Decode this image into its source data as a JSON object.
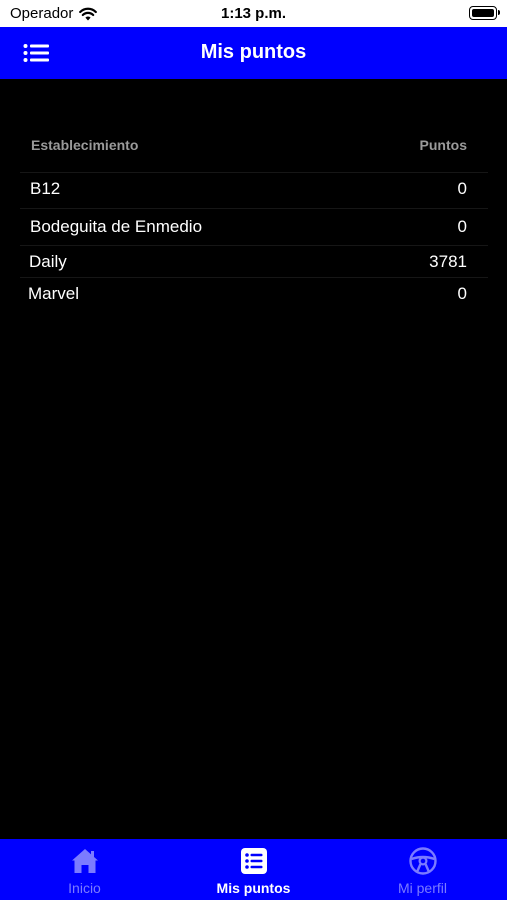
{
  "status_bar": {
    "carrier": "Operador",
    "time": "1:13 p.m."
  },
  "nav": {
    "title": "Mis puntos",
    "menu_icon": "list-icon"
  },
  "table": {
    "header_establishment": "Establecimiento",
    "header_points": "Puntos",
    "rows": [
      {
        "name": "B12",
        "points": "0"
      },
      {
        "name": "Bodeguita de Enmedio",
        "points": "0"
      },
      {
        "name": "Daily",
        "points": "3781"
      },
      {
        "name": "Marvel",
        "points": "0"
      }
    ]
  },
  "tabs": [
    {
      "label": "Inicio",
      "icon": "home-icon"
    },
    {
      "label": "Mis puntos",
      "icon": "list-icon"
    },
    {
      "label": "Mi perfil",
      "icon": "steering-wheel-icon"
    }
  ],
  "colors": {
    "brand": "#0000ff",
    "inactive_tab": "#7b7bff",
    "background": "#000000"
  }
}
